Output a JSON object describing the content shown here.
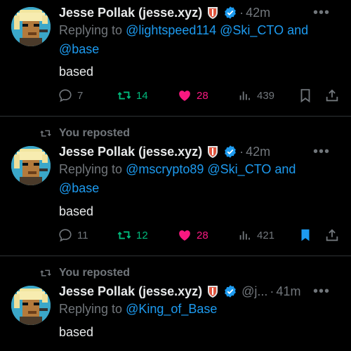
{
  "tweets": [
    {
      "reposted": false,
      "repost_label": "",
      "name": "Jesse Pollak (jesse.xyz)",
      "handle": "",
      "time": "42m",
      "replying_prefix": "Replying to",
      "mentions": [
        "@lightspeed114",
        "@Ski_CTO",
        "@base"
      ],
      "and_word": "and",
      "text": "based",
      "replies": "7",
      "reposts": "14",
      "likes": "28",
      "views": "439",
      "bookmarked": false
    },
    {
      "reposted": true,
      "repost_label": "You reposted",
      "name": "Jesse Pollak (jesse.xyz)",
      "handle": "",
      "time": "42m",
      "replying_prefix": "Replying to",
      "mentions": [
        "@mscrypto89",
        "@Ski_CTO",
        "@base"
      ],
      "and_word": "and",
      "text": "based",
      "replies": "11",
      "reposts": "12",
      "likes": "28",
      "views": "421",
      "bookmarked": true
    },
    {
      "reposted": true,
      "repost_label": "You reposted",
      "name": "Jesse Pollak (jesse.xyz)",
      "handle": "@j...",
      "time": "41m",
      "replying_prefix": "Replying to",
      "mentions": [
        "@King_of_Base"
      ],
      "text": "based"
    }
  ],
  "more_label": "•••",
  "colors": {
    "link": "#1d9bf0",
    "repost": "#00ba7c",
    "like": "#f91880",
    "muted": "#71767b",
    "bookmark": "#1d9bf0"
  },
  "icons": [
    "reply-icon",
    "repost-icon",
    "heart-icon",
    "views-icon",
    "bookmark-icon",
    "share-icon",
    "verified-icon",
    "shield-badge-icon"
  ]
}
